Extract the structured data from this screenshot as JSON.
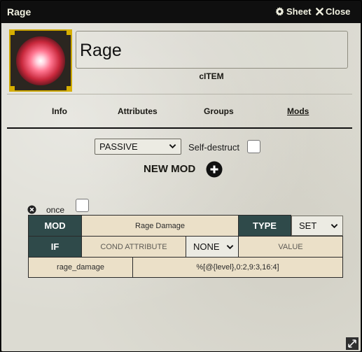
{
  "window": {
    "title": "Rage",
    "sheet_label": "Sheet",
    "close_label": "Close"
  },
  "item": {
    "name": "Rage",
    "type": "cITEM"
  },
  "tabs": [
    {
      "label": "Info"
    },
    {
      "label": "Attributes"
    },
    {
      "label": "Groups"
    },
    {
      "label": "Mods",
      "active": true
    }
  ],
  "controls": {
    "mode_select": "PASSIVE",
    "self_destruct_label": "Self-destruct",
    "new_mod_label": "NEW MOD"
  },
  "mod": {
    "once_label": "once",
    "mod_header": "MOD",
    "mod_name": "Rage Damage",
    "type_header": "TYPE",
    "type_value": "SET",
    "if_header": "IF",
    "cond_attribute_placeholder": "COND ATTRIBUTE",
    "cond_operator": "NONE",
    "value_placeholder": "VALUE",
    "attribute": "rage_damage",
    "formula": "%[@{level},0:2,9:3,16:4]"
  },
  "colors": {
    "titlebar": "#0f0f0f",
    "header_cell": "#2f4a4a",
    "field_cell": "#ebe0c8",
    "image_border": "#c9a400"
  },
  "icons": [
    "gear-icon",
    "close-icon",
    "chevron-down-icon",
    "plus-circle-icon",
    "remove-circle-icon",
    "resize-icon"
  ]
}
